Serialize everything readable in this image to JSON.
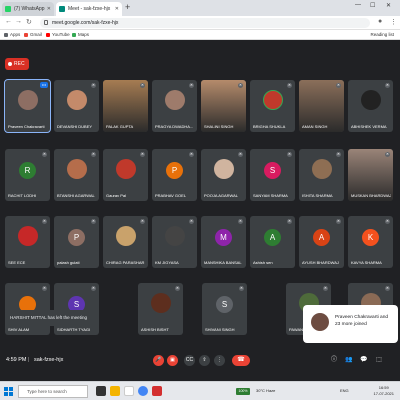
{
  "browser": {
    "tabs": [
      {
        "title": "(7) WhatsApp",
        "favicon_color": "#25d366"
      },
      {
        "title": "Meet - sak-fzxe-hjx",
        "favicon_color": "#00897b"
      }
    ],
    "url": "meet.google.com/sak-fzxe-hjx",
    "bookmarks": [
      {
        "label": "Apps",
        "color": "#5f6368"
      },
      {
        "label": "Gmail",
        "color": "#ea4335"
      },
      {
        "label": "YouTube",
        "color": "#ff0000"
      },
      {
        "label": "Maps",
        "color": "#34a853"
      }
    ],
    "reading_list": "Reading list"
  },
  "meet": {
    "rec_label": "REC",
    "participants_row1": [
      {
        "name": "Praveen Chakravarti",
        "kind": "photo",
        "color": "#8d6e63",
        "active": true
      },
      {
        "name": "DEVANSHI DUBEY",
        "kind": "photo",
        "color": "#c48a6a"
      },
      {
        "name": "PALAK GUPTA",
        "kind": "video",
        "color": "#a67c52"
      },
      {
        "name": "PRAGYA DWADHA...",
        "kind": "photo",
        "color": "#9e7b6b"
      },
      {
        "name": "SHALINI SINGH",
        "kind": "video",
        "color": "#b58b6b"
      },
      {
        "name": "BRIGHA SHUKLA",
        "kind": "photo",
        "color": "#c0392b",
        "ring": "#34a853"
      },
      {
        "name": "AMAN SINGH",
        "kind": "video",
        "color": "#8b6f5a"
      },
      {
        "name": "ABHISHEK VERMA",
        "kind": "photo",
        "color": "#222222"
      }
    ],
    "participants_row2": [
      {
        "name": "RACHIT LODHI",
        "kind": "letter",
        "letter": "R",
        "color": "#2e7d32"
      },
      {
        "name": "BTANSHI AGARWAL",
        "kind": "photo",
        "color": "#b56d4b"
      },
      {
        "name": "Gaurav Pal",
        "kind": "photo",
        "color": "#c0392b"
      },
      {
        "name": "PRABHAV GOEL",
        "kind": "letter",
        "letter": "P",
        "color": "#e8710a"
      },
      {
        "name": "POOJA AGARWAL",
        "kind": "photo",
        "color": "#d0b49f"
      },
      {
        "name": "SANYAM SHARMA",
        "kind": "letter",
        "letter": "S",
        "color": "#d81b60"
      },
      {
        "name": "ISHITA SHARMA",
        "kind": "photo",
        "color": "#8e6e53"
      },
      {
        "name": "MUSKAN BHARDWAJ",
        "kind": "video",
        "color": "#9a8478"
      }
    ],
    "participants_row3": [
      {
        "name": "SEE ECE",
        "kind": "photo",
        "color": "#c62828"
      },
      {
        "name": "palash gulati",
        "kind": "letter",
        "letter": "P",
        "color": "#8d6e63"
      },
      {
        "name": "CHIRAG PARASHAR",
        "kind": "photo",
        "color": "#c9a26b"
      },
      {
        "name": "KM JIGYASA",
        "kind": "photo",
        "color": "#444444"
      },
      {
        "name": "MANSHIKA BANSAL",
        "kind": "letter",
        "letter": "M",
        "color": "#8e24aa"
      },
      {
        "name": "Ashish sen",
        "kind": "letter",
        "letter": "A",
        "color": "#2e7d32"
      },
      {
        "name": "AYUSH BHARDWAJ",
        "kind": "letter",
        "letter": "A",
        "color": "#d84315"
      },
      {
        "name": "KAVYA SHARMA",
        "kind": "letter",
        "letter": "K",
        "color": "#f4511e"
      }
    ],
    "participants_row4": [
      {
        "name": "SHIV ALAM",
        "kind": "letter",
        "letter": "",
        "color": "#e8710a"
      },
      {
        "name": "SIDHARTH TYAGI",
        "kind": "letter",
        "letter": "S",
        "color": "#5e35b1"
      },
      {
        "name": "ASHISH BISHT",
        "kind": "photo",
        "color": "#5d2e1e"
      },
      {
        "name": "SHIVANI SINGH",
        "kind": "letter",
        "letter": "S",
        "color": "#5f6368"
      },
      {
        "name": "PAWAN RAJPUT",
        "kind": "photo",
        "color": "#4e6b3a"
      },
      {
        "name": "",
        "kind": "photo",
        "color": "#8a6a55"
      }
    ],
    "toast": "HARSHIT MITTAL has left the meeting",
    "join_card": "Praveen Chakravarti and 23 more joined",
    "time": "4:59 PM",
    "meeting_code": "sak-fzxe-hjx",
    "controls": [
      "mic-off",
      "camera-off",
      "captions",
      "present",
      "more"
    ],
    "right_icons": [
      "info",
      "people",
      "chat",
      "activities"
    ]
  },
  "taskbar": {
    "search_placeholder": "Type here to search",
    "battery": "100%",
    "tray": "30°C Haze",
    "lang": "ENG",
    "clock_time": "16:59",
    "clock_date": "17-07-2021"
  }
}
